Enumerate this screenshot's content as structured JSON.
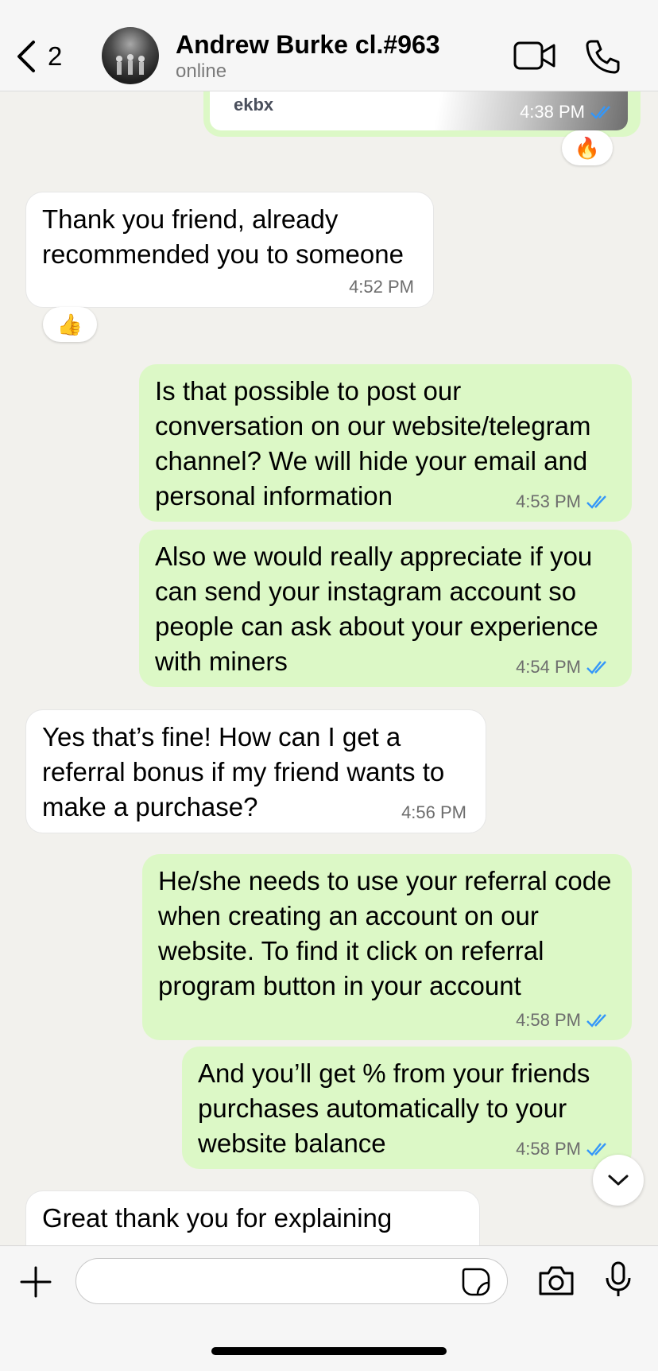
{
  "header": {
    "back_count": "2",
    "contact_name": "Andrew Burke cl.#963",
    "status": "online",
    "icons": [
      "chevron-left-icon",
      "video-camera-icon",
      "phone-icon"
    ]
  },
  "messages": [
    {
      "id": "m0",
      "direction": "out",
      "text": "ekbx",
      "time": "4:38 PM",
      "read": true,
      "reaction": "🔥"
    },
    {
      "id": "m1",
      "direction": "in",
      "text": "Thank you friend, already recommended you to someone",
      "time": "4:52 PM",
      "reaction": "👍"
    },
    {
      "id": "m2",
      "direction": "out",
      "text": "Is that possible to post our conversation on our website/telegram channel? We will hide your email and personal information",
      "time": "4:53 PM",
      "read": true
    },
    {
      "id": "m3",
      "direction": "out",
      "text": "Also we would really appreciate if you can send your instagram account so people can ask about your experience with miners",
      "time": "4:54 PM",
      "read": true
    },
    {
      "id": "m4",
      "direction": "in",
      "text": "Yes that’s fine! How can I get a referral bonus if my friend wants to make a purchase?",
      "time": "4:56 PM"
    },
    {
      "id": "m5",
      "direction": "out",
      "text": "He/she needs to use your referral code when creating an account on our website. To find it click on referral program button in your account",
      "time": "4:58 PM",
      "read": true
    },
    {
      "id": "m6",
      "direction": "out",
      "text": "And you’ll get % from your friends purchases automatically to your website balance",
      "time": "4:58 PM",
      "read": true
    },
    {
      "id": "m7",
      "direction": "in",
      "text": "Great thank you for explaining",
      "time": ""
    }
  ],
  "composer": {
    "value": "",
    "icons": [
      "plus-icon",
      "sticker-icon",
      "camera-icon",
      "microphone-icon"
    ]
  },
  "colors": {
    "outgoing_bubble": "#dcf8c6",
    "incoming_bubble": "#ffffff",
    "chat_background": "#f2f1ed",
    "read_tick": "#3497f9"
  }
}
